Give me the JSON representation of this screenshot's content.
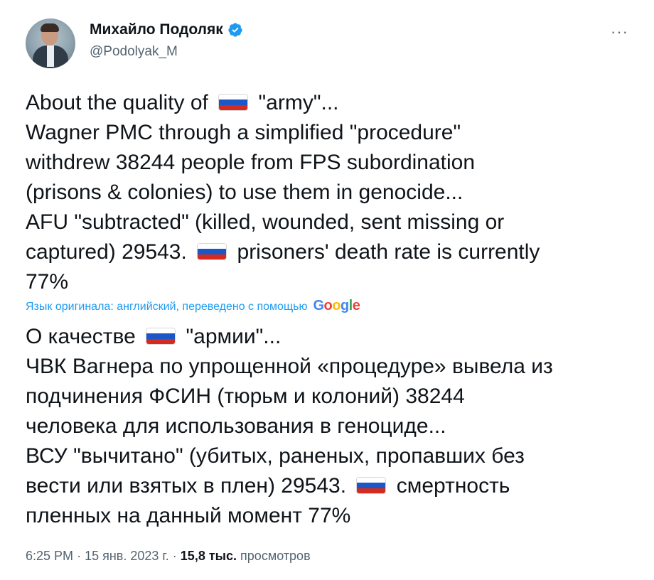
{
  "author": {
    "name": "Михайло Подоляк",
    "handle": "@Podolyak_M",
    "verified": true,
    "more_label": "···"
  },
  "tweet": {
    "original_lines": [
      [
        "About the quality of ",
        "flag-ru",
        " \"army\"..."
      ],
      "Wagner PMC through a simplified \"procedure\"",
      "withdrew 38244 people from FPS subordination",
      "(prisons & colonies) to use them in genocide...",
      "AFU \"subtracted\" (killed, wounded, sent missing or",
      [
        "captured) 29543. ",
        "flag-ru",
        " prisoners' death rate is currently"
      ],
      "77%"
    ],
    "translation_note": "Язык оригинала: английский, переведено с помощью",
    "translation_provider": "Google",
    "translated_lines": [
      [
        "О качестве ",
        "flag-ru",
        " \"армии\"..."
      ],
      "ЧВК Вагнера по упрощенной «процедуре» вывела из",
      "подчинения ФСИН (тюрьм и колоний) 38244",
      "человека для использования в геноциде...",
      "ВСУ \"вычитано\" (убитых, раненых, пропавших без",
      [
        "вести или взятых в плен) 29543. ",
        "flag-ru",
        " смертность"
      ],
      "пленных на данный момент 77%"
    ]
  },
  "meta": {
    "time": "6:25 PM",
    "date": "15 янв. 2023 г.",
    "views_count": "15,8 тыс.",
    "views_label": "просмотров",
    "separator": "·"
  },
  "colors": {
    "text": "#0f1419",
    "secondary": "#536471",
    "link": "#1d9bf0",
    "verified": "#1d9bf0",
    "flag_white": "#ffffff",
    "flag_blue": "#1c57c8",
    "flag_red": "#d52b1e"
  },
  "icons": [
    "verified-badge-icon",
    "more-options-icon",
    "flag-ru"
  ]
}
